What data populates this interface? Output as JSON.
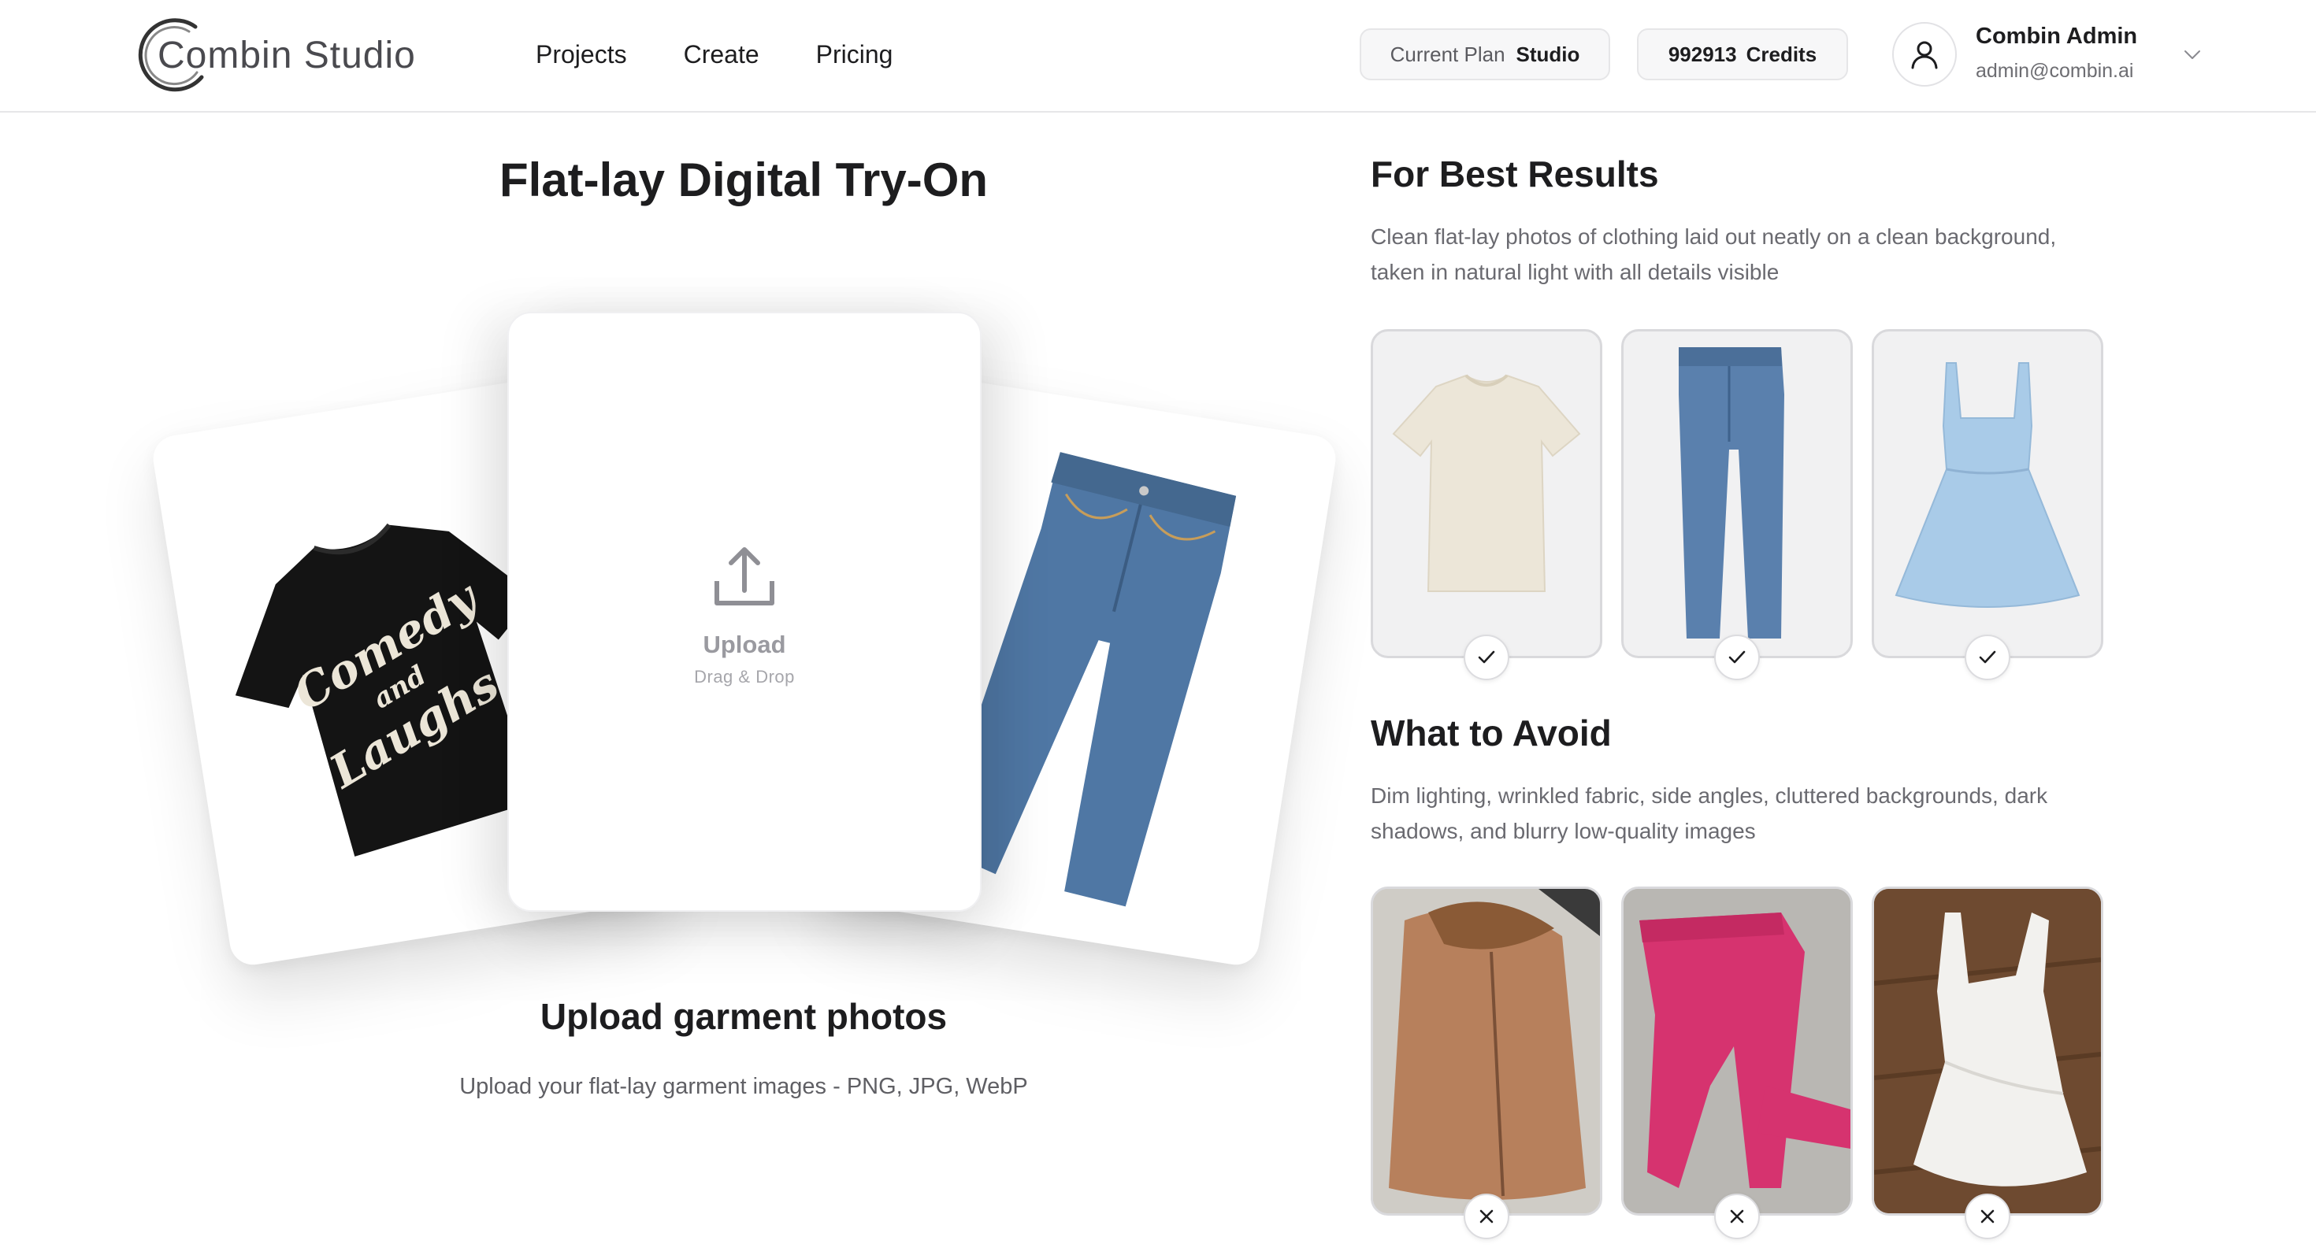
{
  "header": {
    "logo_text": "Combin Studio",
    "nav": [
      "Projects",
      "Create",
      "Pricing"
    ],
    "plan_label": "Current Plan",
    "plan_value": "Studio",
    "credits_value": "992913",
    "credits_label": "Credits",
    "user_name": "Combin Admin",
    "user_email": "admin@combin.ai",
    "icons": [
      "user-icon",
      "chevron-down-icon"
    ]
  },
  "main": {
    "title": "Flat-lay Digital Try-On",
    "upload_label": "Upload",
    "upload_sub": "Drag & Drop",
    "upload_heading": "Upload garment photos",
    "upload_desc": "Upload your flat-lay garment images - PNG, JPG, WebP",
    "left_card_text": [
      "Comedy",
      "and",
      "Laughs"
    ]
  },
  "tips": {
    "best_title": "For Best Results",
    "best_desc": "Clean flat-lay photos of clothing laid out neatly on a clean background, taken in natural light with all details visible",
    "avoid_title": "What to Avoid",
    "avoid_desc": "Dim lighting, wrinkled fabric, side angles, cluttered backgrounds, dark shadows, and blurry low-quality images",
    "good_examples": [
      "t-shirt",
      "jeans",
      "dress"
    ],
    "bad_examples": [
      "jacket",
      "pink-pants",
      "white-dress"
    ]
  },
  "colors": {
    "text": "#1d1d1f",
    "muted": "#6a6a70",
    "border": "#e6e6e8",
    "denim": "#4f77a4",
    "tee_black": "#141414",
    "cream": "#ece6d8",
    "light_blue": "#a9cbe8",
    "pink": "#d6336f",
    "tan": "#b7805c"
  }
}
